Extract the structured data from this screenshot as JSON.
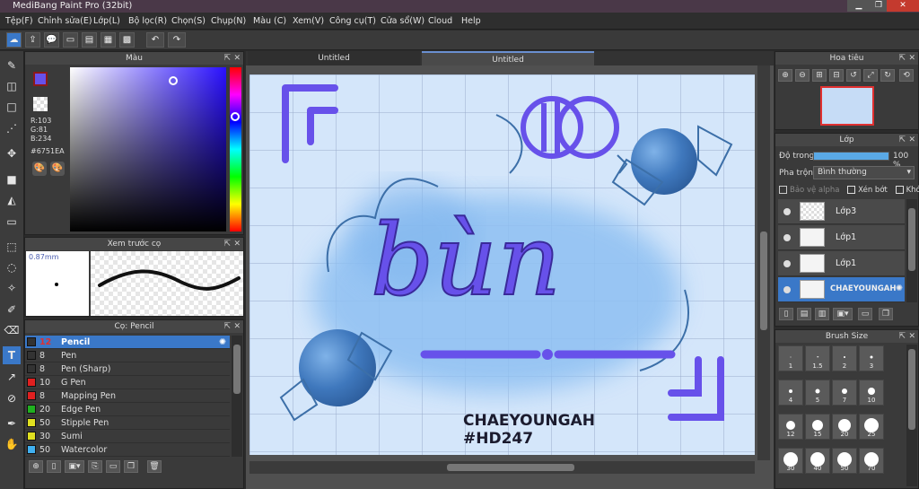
{
  "app": {
    "title": "MediBang Paint Pro (32bit)",
    "win_min": "▁",
    "win_max": "❐",
    "win_close": "✕"
  },
  "menu": [
    "Tệp(F)",
    "Chỉnh sửa(E)",
    "Lớp(L)",
    "Bộ lọc(R)",
    "Chọn(S)",
    "Chụp(N)",
    "Màu (C)",
    "Xem(V)",
    "Công cụ(T)",
    "Cửa sổ(W)",
    "Cloud",
    "Help"
  ],
  "toolbar": {
    "icons": [
      "cloud-icon",
      "export-icon",
      "chat-icon",
      "comment-icon",
      "page-icon",
      "list-icon",
      "grid-icon"
    ],
    "undo": "↶",
    "redo": "↷",
    "glyphs": [
      "☁",
      "⇪",
      "💬",
      "▭",
      "▤",
      "▦",
      "▩"
    ]
  },
  "left_tools": [
    {
      "name": "brush-tool",
      "glyph": "✎"
    },
    {
      "name": "eraser-tool",
      "glyph": "◫"
    },
    {
      "name": "rect-tool",
      "glyph": "□"
    },
    {
      "name": "dot-tool",
      "glyph": "⋰"
    },
    {
      "name": "move-tool",
      "glyph": "✥"
    },
    {
      "name": "fill-rect-tool",
      "glyph": "■"
    },
    {
      "name": "bucket-tool",
      "glyph": "◭"
    },
    {
      "name": "gradient-tool",
      "glyph": "▭"
    },
    {
      "name": "select-rect-tool",
      "glyph": "⬚"
    },
    {
      "name": "lasso-tool",
      "glyph": "◌"
    },
    {
      "name": "magic-wand-tool",
      "glyph": "✧"
    },
    {
      "name": "select-pen-tool",
      "glyph": "✐"
    },
    {
      "name": "select-eraser-tool",
      "glyph": "⌫"
    },
    {
      "name": "text-tool",
      "glyph": "T"
    },
    {
      "name": "operation-tool",
      "glyph": "↗"
    },
    {
      "name": "eyedropper-tool",
      "glyph": "⊘"
    },
    {
      "name": "pen-nib-tool",
      "glyph": "✒"
    },
    {
      "name": "hand-tool",
      "glyph": "✋"
    }
  ],
  "color_panel": {
    "title": "Màu",
    "r": "R:103",
    "g": "G:81",
    "b": "B:234",
    "hex": "#6751EA",
    "fg": "#6751EA",
    "bg": "#8b1a1a"
  },
  "brush_preview": {
    "title": "Xem trước cọ",
    "size": "0.87mm"
  },
  "brush_list": {
    "title": "Cọ: Pencil",
    "items": [
      {
        "size": "12",
        "name": "Pencil",
        "color": "#333333",
        "sel": true
      },
      {
        "size": "8",
        "name": "Pen",
        "color": "#333333"
      },
      {
        "size": "8",
        "name": "Pen (Sharp)",
        "color": "#333333"
      },
      {
        "size": "10",
        "name": "G Pen",
        "color": "#e02020"
      },
      {
        "size": "8",
        "name": "Mapping Pen",
        "color": "#e02020"
      },
      {
        "size": "20",
        "name": "Edge Pen",
        "color": "#20b020"
      },
      {
        "size": "50",
        "name": "Stipple Pen",
        "color": "#e0e020"
      },
      {
        "size": "30",
        "name": "Sumi",
        "color": "#e0e020"
      },
      {
        "size": "50",
        "name": "Watercolor",
        "color": "#40b0f0"
      }
    ]
  },
  "canvas": {
    "tab_inactive": "Untitled",
    "tab_active": "Untitled",
    "main_text": "bùn",
    "sig1": "CHAEYOUNGAH",
    "sig2": "#HD247"
  },
  "navigator": {
    "title": "Hoa tiêu"
  },
  "layers": {
    "title": "Lớp",
    "opacity_label": "Độ trong",
    "opacity_value": "100 %",
    "opacity_fraction": 1.0,
    "blend_label": "Pha trộn",
    "blend_value": "Bình thường",
    "protect": "Bảo vệ alpha",
    "clip": "Xén bớt",
    "lock": "Khóa",
    "items": [
      {
        "name": "Lớp3"
      },
      {
        "name": "Lớp1"
      },
      {
        "name": "Lớp1"
      },
      {
        "name": "CHAEYOUNGAH",
        "sel": true
      }
    ]
  },
  "brush_size": {
    "title": "Brush Size",
    "sizes": [
      "1",
      "1.5",
      "2",
      "3",
      "4",
      "5",
      "7",
      "10",
      "12",
      "15",
      "20",
      "25",
      "30",
      "40",
      "50",
      "70"
    ]
  }
}
